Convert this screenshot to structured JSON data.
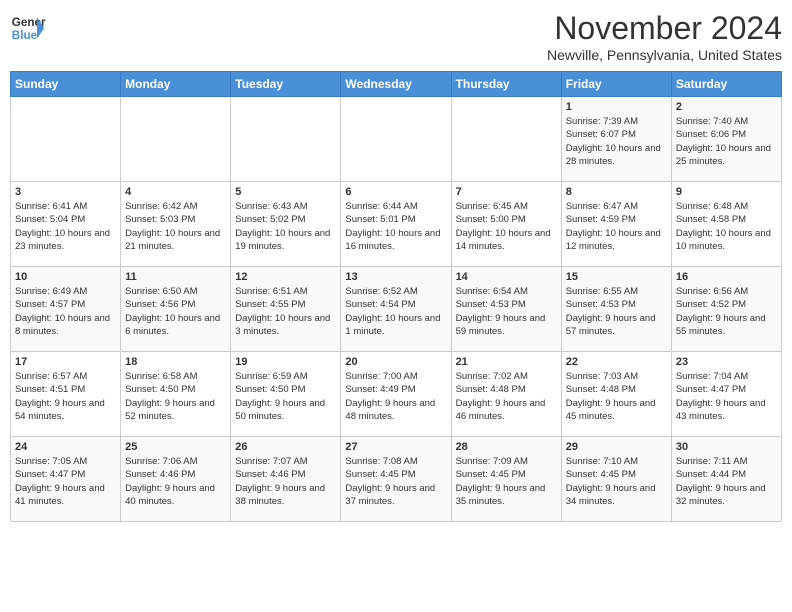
{
  "logo": {
    "line1": "General",
    "line2": "Blue"
  },
  "title": "November 2024",
  "location": "Newville, Pennsylvania, United States",
  "days_header": [
    "Sunday",
    "Monday",
    "Tuesday",
    "Wednesday",
    "Thursday",
    "Friday",
    "Saturday"
  ],
  "weeks": [
    [
      {
        "day": "",
        "info": ""
      },
      {
        "day": "",
        "info": ""
      },
      {
        "day": "",
        "info": ""
      },
      {
        "day": "",
        "info": ""
      },
      {
        "day": "",
        "info": ""
      },
      {
        "day": "1",
        "info": "Sunrise: 7:39 AM\nSunset: 6:07 PM\nDaylight: 10 hours and 28 minutes."
      },
      {
        "day": "2",
        "info": "Sunrise: 7:40 AM\nSunset: 6:06 PM\nDaylight: 10 hours and 25 minutes."
      }
    ],
    [
      {
        "day": "3",
        "info": "Sunrise: 6:41 AM\nSunset: 5:04 PM\nDaylight: 10 hours and 23 minutes."
      },
      {
        "day": "4",
        "info": "Sunrise: 6:42 AM\nSunset: 5:03 PM\nDaylight: 10 hours and 21 minutes."
      },
      {
        "day": "5",
        "info": "Sunrise: 6:43 AM\nSunset: 5:02 PM\nDaylight: 10 hours and 19 minutes."
      },
      {
        "day": "6",
        "info": "Sunrise: 6:44 AM\nSunset: 5:01 PM\nDaylight: 10 hours and 16 minutes."
      },
      {
        "day": "7",
        "info": "Sunrise: 6:45 AM\nSunset: 5:00 PM\nDaylight: 10 hours and 14 minutes."
      },
      {
        "day": "8",
        "info": "Sunrise: 6:47 AM\nSunset: 4:59 PM\nDaylight: 10 hours and 12 minutes."
      },
      {
        "day": "9",
        "info": "Sunrise: 6:48 AM\nSunset: 4:58 PM\nDaylight: 10 hours and 10 minutes."
      }
    ],
    [
      {
        "day": "10",
        "info": "Sunrise: 6:49 AM\nSunset: 4:57 PM\nDaylight: 10 hours and 8 minutes."
      },
      {
        "day": "11",
        "info": "Sunrise: 6:50 AM\nSunset: 4:56 PM\nDaylight: 10 hours and 6 minutes."
      },
      {
        "day": "12",
        "info": "Sunrise: 6:51 AM\nSunset: 4:55 PM\nDaylight: 10 hours and 3 minutes."
      },
      {
        "day": "13",
        "info": "Sunrise: 6:52 AM\nSunset: 4:54 PM\nDaylight: 10 hours and 1 minute."
      },
      {
        "day": "14",
        "info": "Sunrise: 6:54 AM\nSunset: 4:53 PM\nDaylight: 9 hours and 59 minutes."
      },
      {
        "day": "15",
        "info": "Sunrise: 6:55 AM\nSunset: 4:53 PM\nDaylight: 9 hours and 57 minutes."
      },
      {
        "day": "16",
        "info": "Sunrise: 6:56 AM\nSunset: 4:52 PM\nDaylight: 9 hours and 55 minutes."
      }
    ],
    [
      {
        "day": "17",
        "info": "Sunrise: 6:57 AM\nSunset: 4:51 PM\nDaylight: 9 hours and 54 minutes."
      },
      {
        "day": "18",
        "info": "Sunrise: 6:58 AM\nSunset: 4:50 PM\nDaylight: 9 hours and 52 minutes."
      },
      {
        "day": "19",
        "info": "Sunrise: 6:59 AM\nSunset: 4:50 PM\nDaylight: 9 hours and 50 minutes."
      },
      {
        "day": "20",
        "info": "Sunrise: 7:00 AM\nSunset: 4:49 PM\nDaylight: 9 hours and 48 minutes."
      },
      {
        "day": "21",
        "info": "Sunrise: 7:02 AM\nSunset: 4:48 PM\nDaylight: 9 hours and 46 minutes."
      },
      {
        "day": "22",
        "info": "Sunrise: 7:03 AM\nSunset: 4:48 PM\nDaylight: 9 hours and 45 minutes."
      },
      {
        "day": "23",
        "info": "Sunrise: 7:04 AM\nSunset: 4:47 PM\nDaylight: 9 hours and 43 minutes."
      }
    ],
    [
      {
        "day": "24",
        "info": "Sunrise: 7:05 AM\nSunset: 4:47 PM\nDaylight: 9 hours and 41 minutes."
      },
      {
        "day": "25",
        "info": "Sunrise: 7:06 AM\nSunset: 4:46 PM\nDaylight: 9 hours and 40 minutes."
      },
      {
        "day": "26",
        "info": "Sunrise: 7:07 AM\nSunset: 4:46 PM\nDaylight: 9 hours and 38 minutes."
      },
      {
        "day": "27",
        "info": "Sunrise: 7:08 AM\nSunset: 4:45 PM\nDaylight: 9 hours and 37 minutes."
      },
      {
        "day": "28",
        "info": "Sunrise: 7:09 AM\nSunset: 4:45 PM\nDaylight: 9 hours and 35 minutes."
      },
      {
        "day": "29",
        "info": "Sunrise: 7:10 AM\nSunset: 4:45 PM\nDaylight: 9 hours and 34 minutes."
      },
      {
        "day": "30",
        "info": "Sunrise: 7:11 AM\nSunset: 4:44 PM\nDaylight: 9 hours and 32 minutes."
      }
    ]
  ]
}
